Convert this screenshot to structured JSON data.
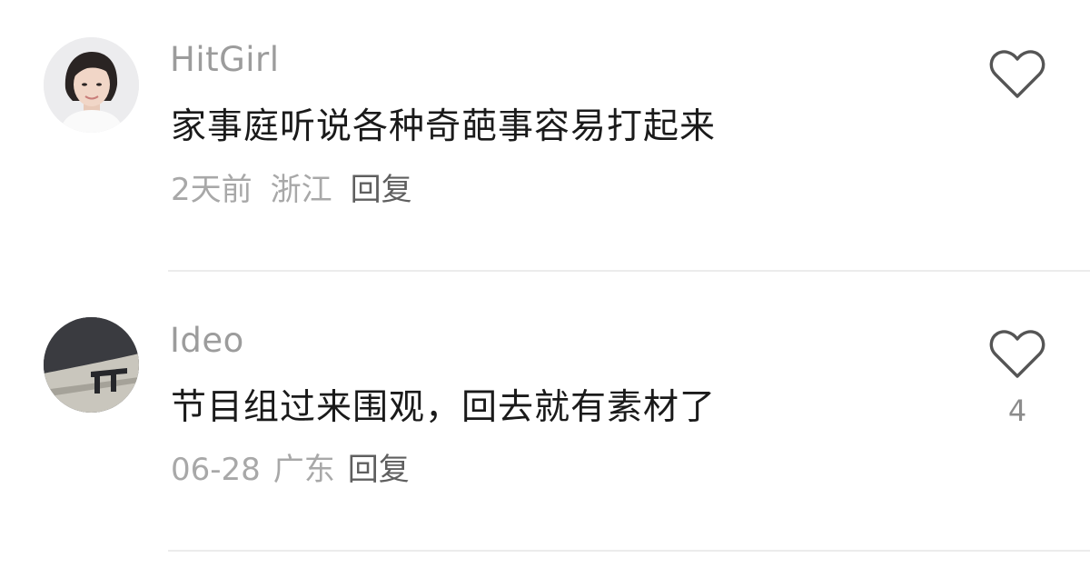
{
  "comments": [
    {
      "username": "HitGirl",
      "text": "家事庭听说各种奇葩事容易打起来",
      "time": "2天前",
      "location": "浙江",
      "reply_label": "回复",
      "like_count": "",
      "avatar": "portrait-photo"
    },
    {
      "username": "Ideo",
      "text": "节目组过来围观，回去就有素材了",
      "time": "06-28",
      "location": "广东",
      "reply_label": "回复",
      "like_count": "4",
      "avatar": "gray-photo"
    }
  ],
  "icons": {
    "like": "heart-outline-icon"
  },
  "colors": {
    "username": "#9c9c9c",
    "text": "#1a1a1a",
    "meta": "#a8a8a8",
    "reply": "#5f5f5f",
    "divider": "#ececec",
    "heart": "#555555"
  }
}
